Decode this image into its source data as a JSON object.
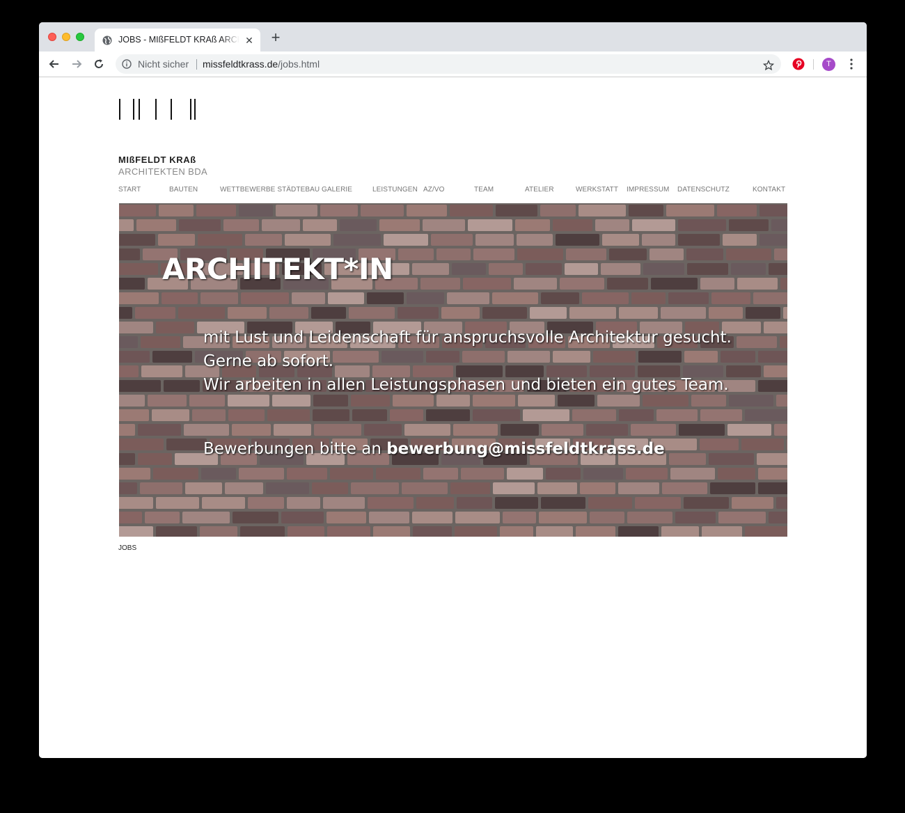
{
  "browser": {
    "tab_title": "JOBS - MIßFELDT KRAß ARCHITEKTEN BDA",
    "security_label": "Nicht sicher",
    "url_host": "missfeldtkrass.de",
    "url_path": "/jobs.html",
    "avatar_initial": "T"
  },
  "site": {
    "brand_name": "MIßFELDT KRAß",
    "brand_sub": "ARCHITEKTEN BDA",
    "menu": [
      {
        "label": "START"
      },
      {
        "label": "BAUTEN"
      },
      {
        "label": "WETTBEWERBE STÄDTEBAU"
      },
      {
        "label": "GALERIE"
      },
      {
        "label": "LEISTUNGEN"
      },
      {
        "label": "AZ/VO"
      },
      {
        "label": "TEAM"
      },
      {
        "label": "ATELIER"
      },
      {
        "label": "WERKSTATT"
      },
      {
        "label": "IMPRESSUM"
      },
      {
        "label": "DATENSCHUTZ"
      },
      {
        "label": "KONTAKT"
      }
    ]
  },
  "hero": {
    "title": "ARCHITEKT*IN",
    "line1": "mit Lust und Leidenschaft für anspruchsvolle Architektur gesucht.",
    "line2": "Gerne ab sofort.",
    "line3": "Wir arbeiten in allen Leistungsphasen und bieten ein gutes Team.",
    "apply_prefix": "Bewerbungen bitte an ",
    "apply_email": "bewerbung@missfeldtkrass.de"
  },
  "caption": "JOBS"
}
